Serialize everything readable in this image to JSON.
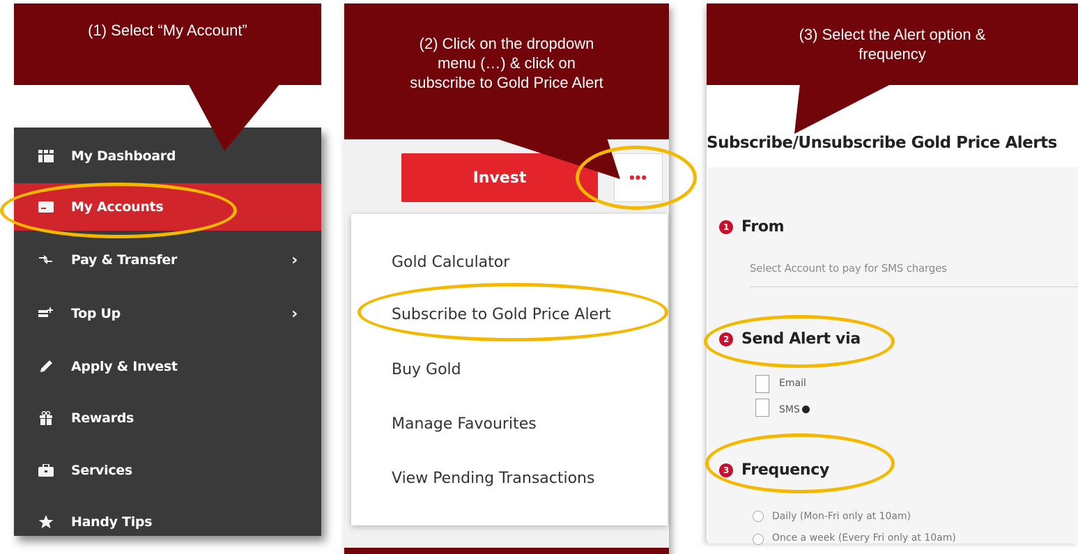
{
  "colors": {
    "callout_bg": "#720509",
    "highlight": "#f5b800",
    "accent_red": "#e3242b",
    "sidebar_bg": "#3a3a3a",
    "sidebar_active": "#d0252b"
  },
  "callouts": {
    "step1": "(1) Select “My Account”",
    "step2_line1": "(2) Click on the dropdown",
    "step2_line2": "menu (…) & click on",
    "step2_line3": "subscribe to Gold Price Alert",
    "step3_line1": "(3) Select the Alert option &",
    "step3_line2": "frequency"
  },
  "sidebar": {
    "items": [
      {
        "label": "My Dashboard",
        "icon": "dashboard-icon"
      },
      {
        "label": "My Accounts",
        "icon": "card-icon",
        "active": true
      },
      {
        "label": "Pay & Transfer",
        "icon": "transfer-arrows-icon",
        "has_submenu": true
      },
      {
        "label": "Top Up",
        "icon": "top-up-icon",
        "has_submenu": true
      },
      {
        "label": "Apply & Invest",
        "icon": "pencil-icon"
      },
      {
        "label": "Rewards",
        "icon": "gift-icon"
      },
      {
        "label": "Services",
        "icon": "briefcase-icon"
      },
      {
        "label": "Handy Tips",
        "icon": "star-icon"
      }
    ]
  },
  "menu": {
    "invest_label": "Invest",
    "more_label": "•••",
    "items": [
      "Gold Calculator",
      "Subscribe to Gold Price Alert",
      "Buy Gold",
      "Manage Favourites",
      "View Pending Transactions"
    ]
  },
  "form": {
    "title": "Subscribe/Unsubscribe Gold Price Alerts",
    "from": {
      "number": "1",
      "label": "From",
      "placeholder": "Select Account to pay for SMS charges"
    },
    "send_alert": {
      "number": "2",
      "label": "Send Alert via",
      "options": [
        "Email",
        "SMS"
      ]
    },
    "frequency": {
      "number": "3",
      "label": "Frequency",
      "options": [
        "Daily (Mon-Fri only at 10am)",
        "Once a week (Every Fri only at 10am)"
      ]
    }
  }
}
